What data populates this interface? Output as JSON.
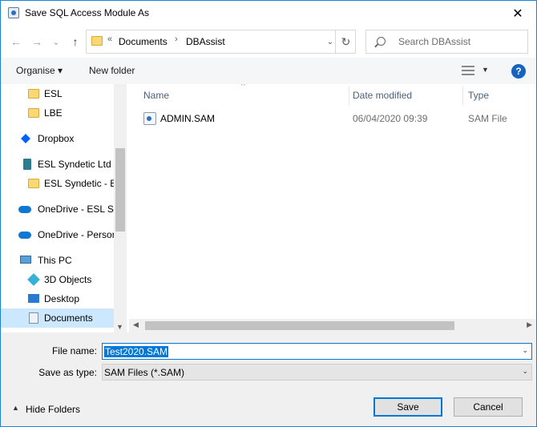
{
  "window": {
    "title": "Save SQL Access Module As",
    "close_glyph": "✕"
  },
  "nav": {
    "back_glyph": "←",
    "forward_glyph": "→",
    "dropdown_glyph": "⌄",
    "up_glyph": "↑",
    "breadcrumb": [
      "Documents",
      "DBAssist"
    ],
    "overflow": "«",
    "separator": "›",
    "refresh_glyph": "↻",
    "search_placeholder": "Search DBAssist"
  },
  "toolbar": {
    "organise_label": "Organise ▾",
    "new_folder_label": "New folder",
    "help_glyph": "?"
  },
  "sidebar": {
    "items": [
      {
        "label": "ESL",
        "icon": "folder-icon"
      },
      {
        "label": "LBE",
        "icon": "folder-icon"
      },
      {
        "label": "Dropbox",
        "icon": "dropbox-icon"
      },
      {
        "label": "ESL Syndetic Ltd",
        "icon": "building-icon"
      },
      {
        "label": "ESL Syndetic - ES",
        "icon": "folder-icon"
      },
      {
        "label": "OneDrive - ESL Sy",
        "icon": "cloud-icon"
      },
      {
        "label": "OneDrive - Persor",
        "icon": "cloud-icon"
      },
      {
        "label": "This PC",
        "icon": "pc-icon"
      },
      {
        "label": "3D Objects",
        "icon": "cube-icon"
      },
      {
        "label": "Desktop",
        "icon": "desktop-icon"
      },
      {
        "label": "Documents",
        "icon": "documents-icon",
        "selected": true
      }
    ]
  },
  "file_list": {
    "columns": {
      "name": "Name",
      "date": "Date modified",
      "type": "Type"
    },
    "sort_glyph": "^",
    "rows": [
      {
        "name": "ADMIN.SAM",
        "date": "06/04/2020 09:39",
        "type": "SAM File"
      }
    ]
  },
  "form": {
    "file_name_label": "File name:",
    "file_name_value": "Test2020.SAM",
    "save_type_label": "Save as type:",
    "save_type_value": "SAM Files (*.SAM)",
    "dropdown_glyph": "⌄"
  },
  "footer": {
    "hide_folders_label": "Hide Folders",
    "hide_caret": "▲",
    "save_label": "Save",
    "cancel_label": "Cancel"
  },
  "scroll_glyphs": {
    "up": "▲",
    "down": "▼",
    "left": "◀",
    "right": "▶"
  },
  "colors": {
    "accent": "#0078d7",
    "selection": "#cce8ff",
    "help": "#1565c0"
  }
}
